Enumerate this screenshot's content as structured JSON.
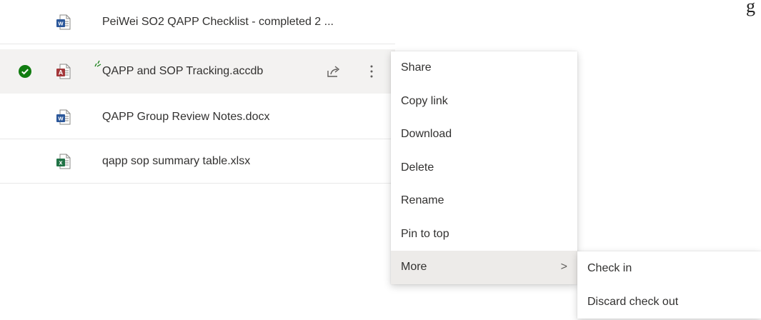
{
  "corner_text": "g",
  "files": [
    {
      "name": "PeiWei SO2 QAPP Checklist - completed 2 ...",
      "type": "word",
      "type_letter": "w",
      "selected": false
    },
    {
      "name": "QAPP and SOP Tracking.accdb",
      "type": "access",
      "type_letter": "A",
      "selected": true
    },
    {
      "name": "QAPP Group Review Notes.docx",
      "type": "word",
      "type_letter": "w",
      "selected": false
    },
    {
      "name": "qapp sop summary table.xlsx",
      "type": "excel",
      "type_letter": "x",
      "selected": false
    }
  ],
  "context_menu": {
    "items": [
      "Share",
      "Copy link",
      "Download",
      "Delete",
      "Rename",
      "Pin to top"
    ],
    "more_label": "More",
    "more_chevron": ">"
  },
  "submenu": {
    "items": [
      "Check in",
      "Discard check out"
    ]
  },
  "colors": {
    "word": "#2b579a",
    "access": "#a4373a",
    "excel": "#217346",
    "check": "#107c10",
    "selected_bg": "#f3f2f1"
  }
}
